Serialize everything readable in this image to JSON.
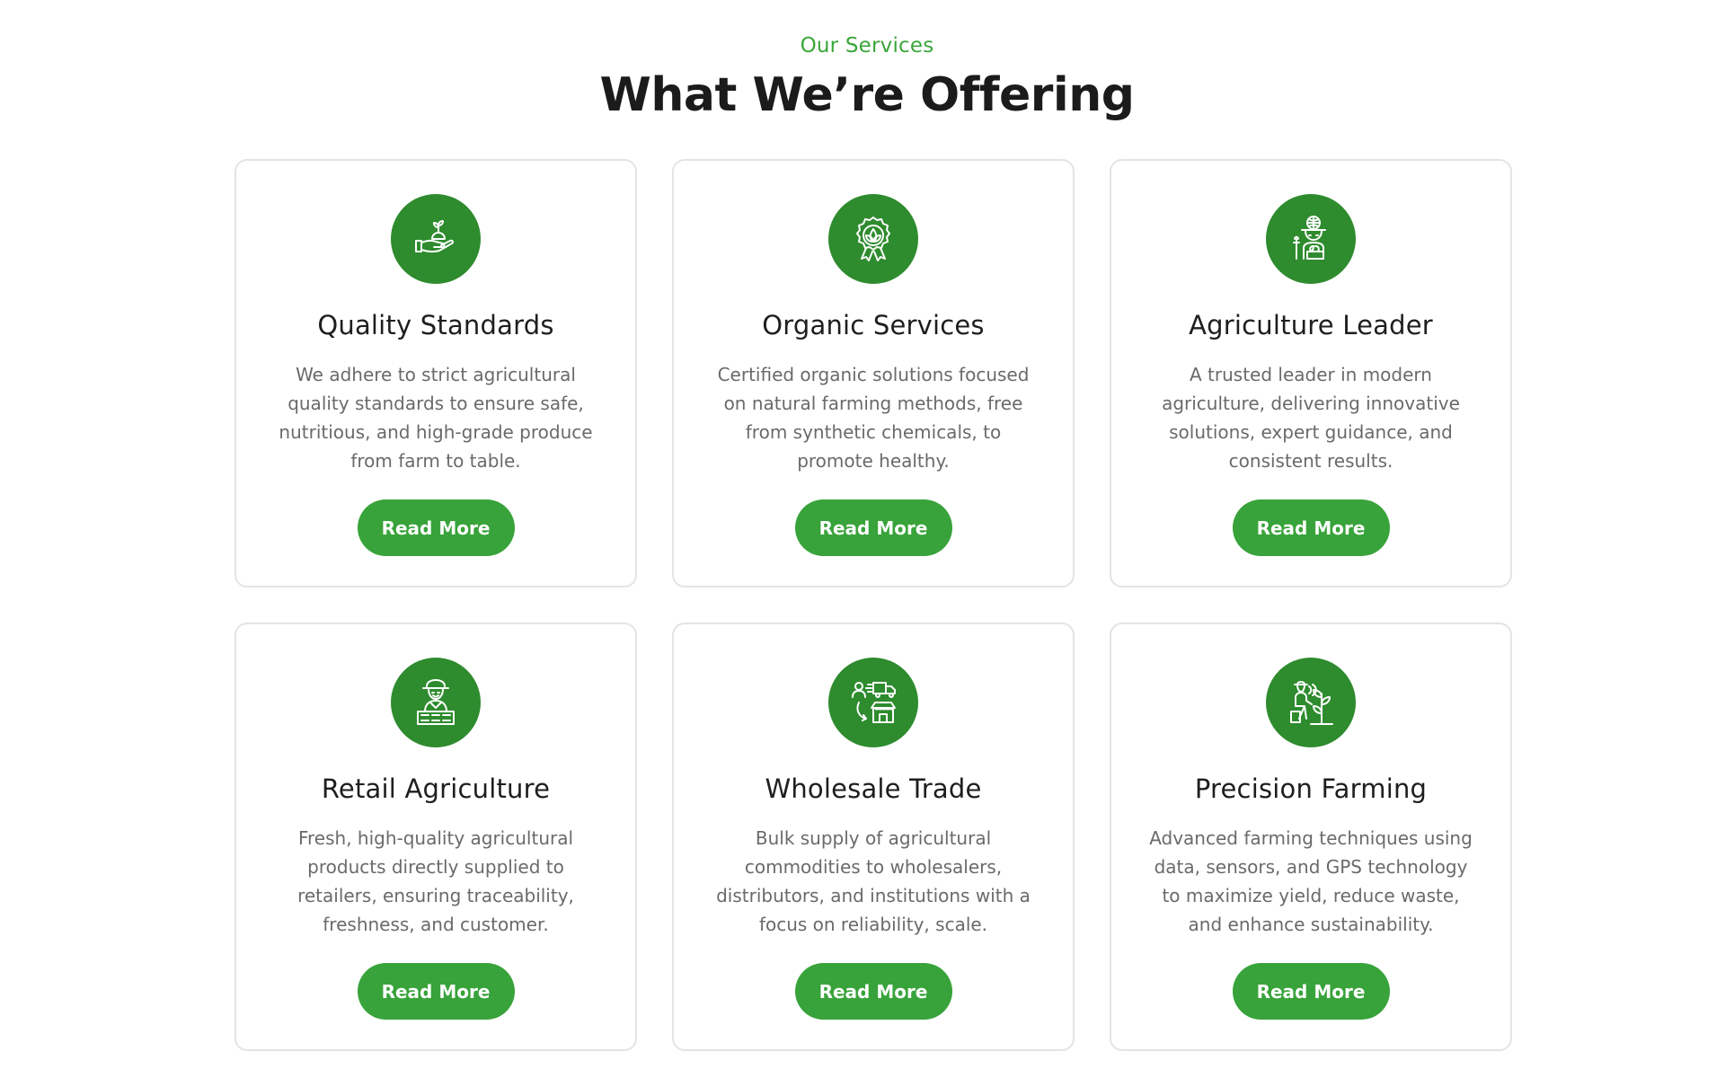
{
  "header": {
    "eyebrow": "Our Services",
    "title": "What We’re Offering"
  },
  "colors": {
    "accent": "#38a33a",
    "icon_bg": "#2e8b2e",
    "eyebrow": "#3aa63a"
  },
  "cards": [
    {
      "icon": "hand-sprout-icon",
      "title": "Quality Standards",
      "description": "We adhere to strict agricultural quality standards to ensure safe, nutritious, and high-grade produce from farm to table.",
      "button_label": "Read More"
    },
    {
      "icon": "organic-badge-icon",
      "title": "Organic Services",
      "description": "Certified organic solutions focused on natural farming methods, free from synthetic chemicals, to promote healthy.",
      "button_label": "Read More"
    },
    {
      "icon": "farmer-leader-icon",
      "title": "Agriculture Leader",
      "description": "A trusted leader in modern agriculture, delivering innovative solutions, expert guidance, and consistent results.",
      "button_label": "Read More"
    },
    {
      "icon": "retail-farmer-icon",
      "title": "Retail Agriculture",
      "description": "Fresh, high-quality agricultural products directly supplied to retailers, ensuring traceability, freshness, and customer.",
      "button_label": "Read More"
    },
    {
      "icon": "wholesale-trade-icon",
      "title": "Wholesale Trade",
      "description": "Bulk supply of agricultural commodities to wholesalers, distributors, and institutions with a focus on reliability, scale.",
      "button_label": "Read More"
    },
    {
      "icon": "precision-farming-icon",
      "title": "Precision Farming",
      "description": "Advanced farming techniques using data, sensors, and GPS technology to maximize yield, reduce waste, and enhance sustainability.",
      "button_label": "Read More"
    }
  ]
}
